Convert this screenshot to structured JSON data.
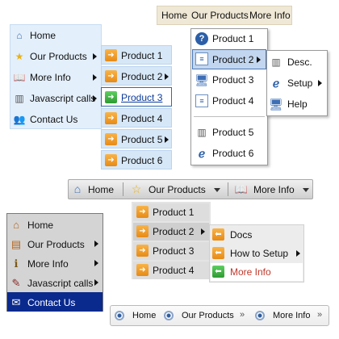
{
  "menu_blue": {
    "items": [
      {
        "label": "Home",
        "icon": "home-icon"
      },
      {
        "label": "Our Products",
        "icon": "star-icon"
      },
      {
        "label": "More Info",
        "icon": "book-icon"
      },
      {
        "label": "Javascript calls",
        "icon": "chart-icon"
      },
      {
        "label": "Contact Us",
        "icon": "people-icon"
      }
    ],
    "submenu": [
      "Product 1",
      "Product 2",
      "Product 3",
      "Product 4",
      "Product 5",
      "Product 6"
    ],
    "selected": "Product 3"
  },
  "menu_beige": {
    "bar": [
      "Home",
      "Our Products",
      "More Info"
    ],
    "submenu": [
      "Product 1",
      "Product 2",
      "Product 3",
      "Product 4",
      "Product 5",
      "Product 6"
    ],
    "selected": "Product 2",
    "sub_submenu": [
      "Desc.",
      "Setup",
      "Help"
    ]
  },
  "menu_gray": {
    "bar": [
      "Home",
      "Our Products",
      "More Info"
    ],
    "submenu": [
      "Product 1",
      "Product 2",
      "Product 3",
      "Product 4"
    ],
    "selected": "Product 2",
    "sub_submenu": [
      "Docs",
      "How to Setup",
      "More Info"
    ],
    "accent": "#c0392b"
  },
  "menu_dark": {
    "items": [
      "Home",
      "Our Products",
      "More Info",
      "Javascript calls",
      "Contact Us"
    ],
    "selected": "Contact Us",
    "selected_color": "#0a2a8e"
  },
  "breadcrumb": {
    "items": [
      "Home",
      "Our Products",
      "More Info"
    ],
    "separator": "»"
  }
}
